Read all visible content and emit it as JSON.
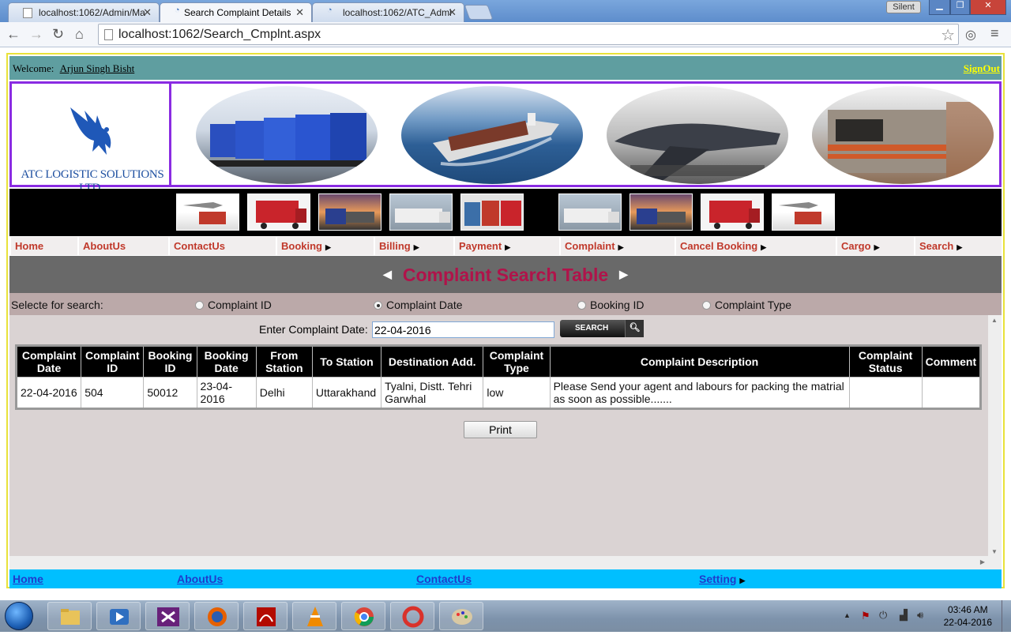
{
  "browser": {
    "tabs": [
      {
        "title": "localhost:1062/Admin/Ma"
      },
      {
        "title": "Search Complaint Details"
      },
      {
        "title": "localhost:1062/ATC_Admi"
      }
    ],
    "active_tab": 1,
    "silent_label": "Silent",
    "url": "localhost:1062/Search_Cmplnt.aspx"
  },
  "welcome": {
    "label": "Welcome:",
    "user": "Arjun Singh Bisht",
    "signout": "SignOut"
  },
  "logo": {
    "company": "ATC LOGISTIC SOLUTIONS LTD.."
  },
  "menu": {
    "items": [
      {
        "label": "Home",
        "has_arrow": false
      },
      {
        "label": "AboutUs",
        "has_arrow": false
      },
      {
        "label": "ContactUs",
        "has_arrow": false
      },
      {
        "label": "Booking",
        "has_arrow": true
      },
      {
        "label": "Billing",
        "has_arrow": true
      },
      {
        "label": "Payment",
        "has_arrow": true
      },
      {
        "label": "Complaint",
        "has_arrow": true
      },
      {
        "label": "Cancel Booking",
        "has_arrow": true
      },
      {
        "label": "Cargo",
        "has_arrow": true
      },
      {
        "label": "Search",
        "has_arrow": true
      }
    ]
  },
  "page_title": "Complaint Search Table",
  "search": {
    "select_label": "Selecte for search:",
    "options": [
      {
        "label": "Complaint ID",
        "selected": false
      },
      {
        "label": "Complaint Date",
        "selected": true
      },
      {
        "label": "Booking ID",
        "selected": false
      },
      {
        "label": "Complaint Type",
        "selected": false
      }
    ],
    "date_label": "Enter Complaint Date:",
    "date_value": "22-04-2016",
    "button_label": "SEARCH"
  },
  "table": {
    "headers": [
      "Complaint Date",
      "Complaint ID",
      "Booking ID",
      "Booking Date",
      "From Station",
      "To Station",
      "Destination Add.",
      "Complaint Type",
      "Complaint Description",
      "Complaint Status",
      "Comment"
    ],
    "rows": [
      [
        "22-04-2016",
        "504",
        "50012",
        "23-04-2016",
        "Delhi",
        "Uttarakhand",
        "Tyalni, Distt. Tehri Garwhal",
        "low",
        "Please Send your agent and labours for packing the matrial as soon as possible.......",
        "",
        ""
      ]
    ]
  },
  "print_label": "Print",
  "footer": {
    "links": [
      {
        "label": "Home"
      },
      {
        "label": "AboutUs"
      },
      {
        "label": "ContactUs"
      },
      {
        "label": "Setting"
      }
    ]
  },
  "taskbar": {
    "time": "03:46 AM",
    "date": "22-04-2016"
  },
  "colors": {
    "welcome_bar": "#5f9ea0",
    "banner_border": "#8a2be2",
    "menu_text": "#c0392b",
    "title_text": "#b0134a",
    "footer_bar": "#00bfff"
  }
}
